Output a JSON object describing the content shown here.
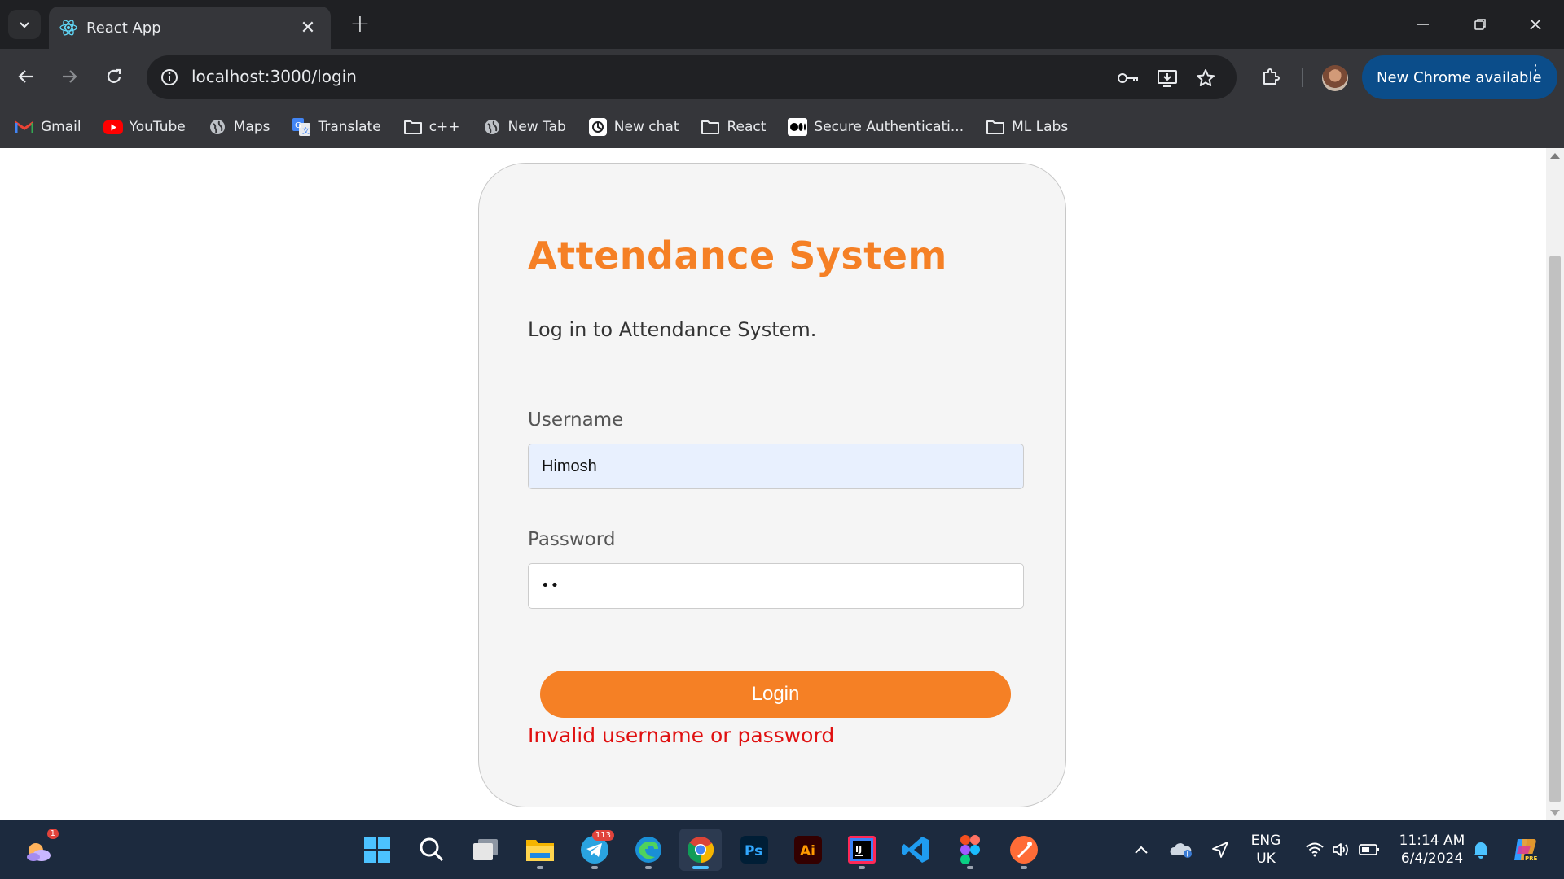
{
  "browser": {
    "tab": {
      "title": "React App"
    },
    "address_bar": {
      "url": "localhost:3000/login"
    },
    "update_button": {
      "label": "New Chrome available"
    },
    "bookmarks": [
      {
        "label": "Gmail",
        "icon": "gmail-icon"
      },
      {
        "label": "YouTube",
        "icon": "youtube-icon"
      },
      {
        "label": "Maps",
        "icon": "globe-icon"
      },
      {
        "label": "Translate",
        "icon": "translate-icon"
      },
      {
        "label": "c++",
        "icon": "folder-icon"
      },
      {
        "label": "New Tab",
        "icon": "globe-icon"
      },
      {
        "label": "New chat",
        "icon": "openai-icon"
      },
      {
        "label": "React",
        "icon": "folder-icon"
      },
      {
        "label": "Secure Authenticati...",
        "icon": "medium-icon"
      },
      {
        "label": "ML Labs",
        "icon": "folder-icon"
      }
    ]
  },
  "login_page": {
    "title": "Attendance System",
    "subtitle": "Log in to Attendance System.",
    "username": {
      "label": "Username",
      "value": "Himosh"
    },
    "password": {
      "label": "Password",
      "masked_value": "••"
    },
    "login_button": {
      "label": "Login"
    },
    "error_message": "Invalid username or password"
  },
  "colors": {
    "accent": "#f58025",
    "error": "#e01010",
    "card_bg": "#f5f5f5",
    "autofill_bg": "#e8f0fe"
  },
  "taskbar": {
    "widgets_badge": "1",
    "telegram_badge": "113",
    "language": {
      "line1": "ENG",
      "line2": "UK"
    },
    "clock": {
      "time": "11:14 AM",
      "date": "6/4/2024"
    }
  }
}
